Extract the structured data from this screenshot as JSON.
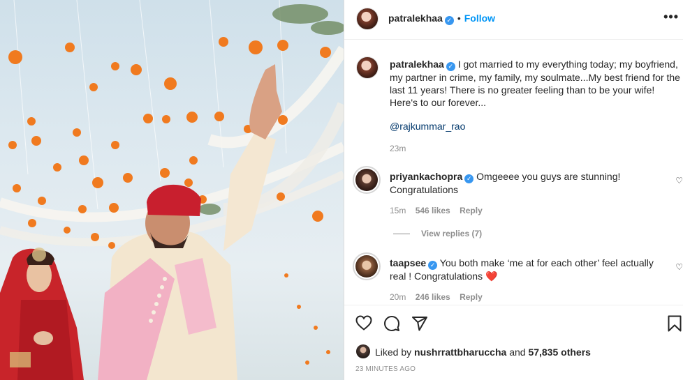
{
  "post": {
    "username": "patralekhaa",
    "follow_label": "Follow",
    "dot": "•",
    "more_label": "•••",
    "caption": "I got married to my everything today; my boyfriend, my partner in crime, my family, my soulmate...My best friend for the last 11 years! There is no greater feeling than to be your wife! Here's to our forever...",
    "mention": "@rajkummar_rao",
    "caption_time": "23m"
  },
  "comments": [
    {
      "username": "priyankachopra",
      "text": "Omgeeee you guys are stunning! Congratulations",
      "time": "15m",
      "likes": "546 likes",
      "reply_label": "Reply",
      "view_replies": "View replies (7)"
    },
    {
      "username": "taapsee",
      "text": "You both make ‘me at for each other’ feel actually real ! Congratulations",
      "heart": "❤️",
      "time": "20m",
      "likes": "246 likes",
      "reply_label": "Reply"
    }
  ],
  "actions": {
    "icons": [
      "heart-icon",
      "comment-icon",
      "share-icon",
      "bookmark-icon"
    ]
  },
  "likes": {
    "prefix": "Liked by",
    "user": "nushrrattbharuccha",
    "suffix": "and",
    "others": "57,835 others"
  },
  "timestamp": "23 MINUTES AGO",
  "colors": {
    "link": "#0095f6",
    "verified": "#3897f0",
    "mention": "#00376b",
    "heart": "#ed4956"
  }
}
